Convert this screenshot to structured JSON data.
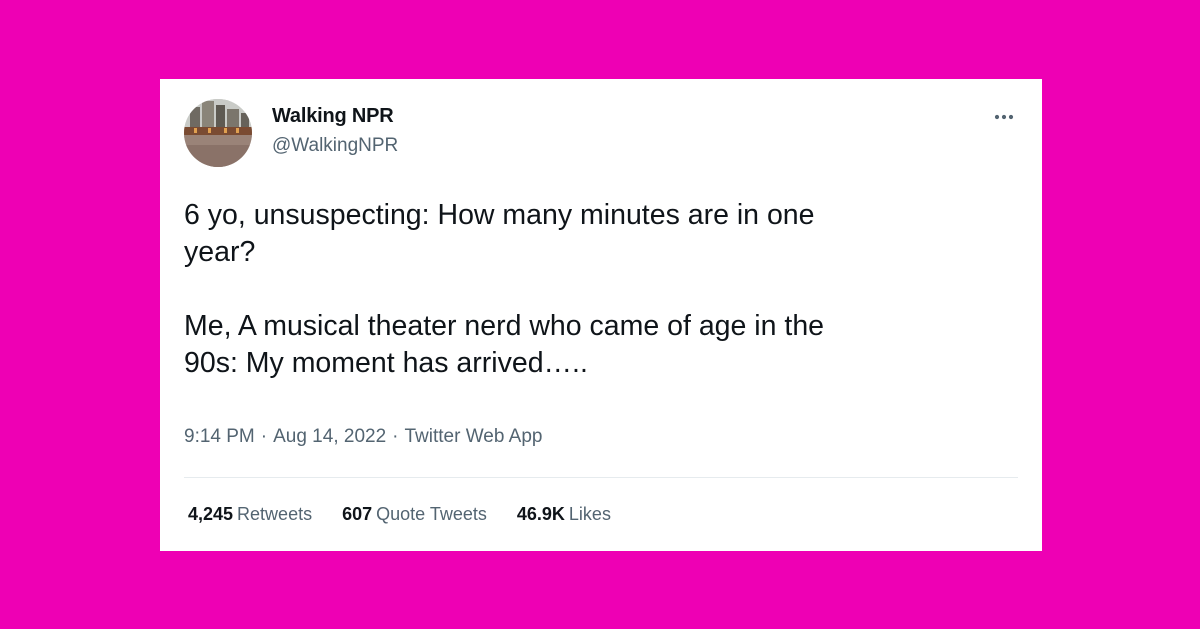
{
  "tweet": {
    "author": {
      "display_name": "Walking NPR",
      "handle": "@WalkingNPR"
    },
    "text": "6 yo, unsuspecting: How many minutes are in one\nyear?\n\nMe, A musical theater nerd who came of age in the\n90s: My moment has arrived…..",
    "time": "9:14 PM",
    "separator": "·",
    "date": "Aug 14, 2022",
    "source": "Twitter Web App",
    "stats": {
      "retweets_count": "4,245",
      "retweets_label": "Retweets",
      "quote_tweets_count": "607",
      "quote_tweets_label": "Quote Tweets",
      "likes_count": "46.9K",
      "likes_label": "Likes"
    }
  },
  "colors": {
    "background": "#ee00b4",
    "card": "#ffffff",
    "text_primary": "#0f1419",
    "text_secondary": "#536471"
  },
  "icons": {
    "more": "more-horizontal-icon",
    "avatar": "avatar-image"
  }
}
